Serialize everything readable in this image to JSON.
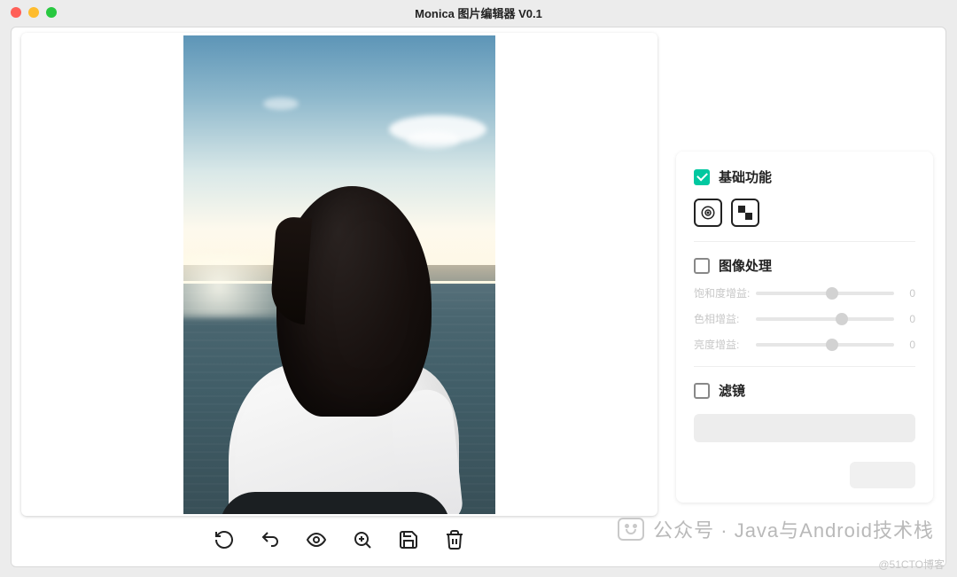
{
  "window": {
    "title": "Monica 图片编辑器 V0.1"
  },
  "toolbar": {
    "reset": "reset",
    "undo": "undo",
    "preview": "preview",
    "zoom_in": "zoom-in",
    "save": "save",
    "delete": "delete"
  },
  "panel": {
    "basic": {
      "label": "基础功能",
      "checked": true
    },
    "image_processing": {
      "label": "图像处理",
      "checked": false,
      "sliders": [
        {
          "label": "饱和度增益:",
          "value": 0,
          "pos": 55
        },
        {
          "label": "色相增益:",
          "value": 0,
          "pos": 62
        },
        {
          "label": "亮度增益:",
          "value": 0,
          "pos": 55
        }
      ]
    },
    "filter": {
      "label": "滤镜",
      "checked": false
    }
  },
  "watermark": {
    "text": "公众号 · Java与Android技术栈"
  },
  "attribution": "@51CTO博客"
}
